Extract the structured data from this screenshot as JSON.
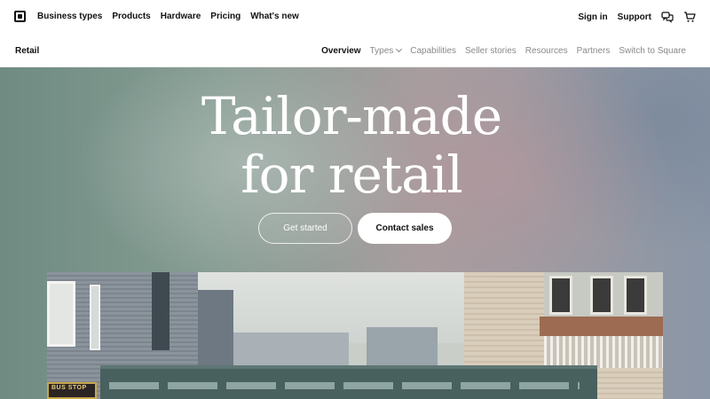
{
  "top_nav": {
    "logo_icon": "square-logo-icon",
    "menu": [
      "Business types",
      "Products",
      "Hardware",
      "Pricing",
      "What's new"
    ],
    "sign_in": "Sign in",
    "support": "Support",
    "chat_icon": "chat-bubbles-icon",
    "cart_icon": "cart-icon"
  },
  "sub_nav": {
    "title": "Retail",
    "links": [
      {
        "label": "Overview",
        "active": true
      },
      {
        "label": "Types",
        "active": false,
        "has_dropdown": true
      },
      {
        "label": "Capabilities",
        "active": false
      },
      {
        "label": "Seller stories",
        "active": false
      },
      {
        "label": "Resources",
        "active": false
      },
      {
        "label": "Partners",
        "active": false
      },
      {
        "label": "Switch to Square",
        "active": false
      }
    ]
  },
  "hero": {
    "title_line1": "Tailor-made",
    "title_line2": "for retail",
    "primary_button": "Get started",
    "secondary_button": "Contact sales",
    "photo": {
      "sign_text": "BUS STOP"
    }
  },
  "colors": {
    "text": "#111111",
    "muted": "#8a8a8a",
    "hero_text": "#ffffff"
  }
}
